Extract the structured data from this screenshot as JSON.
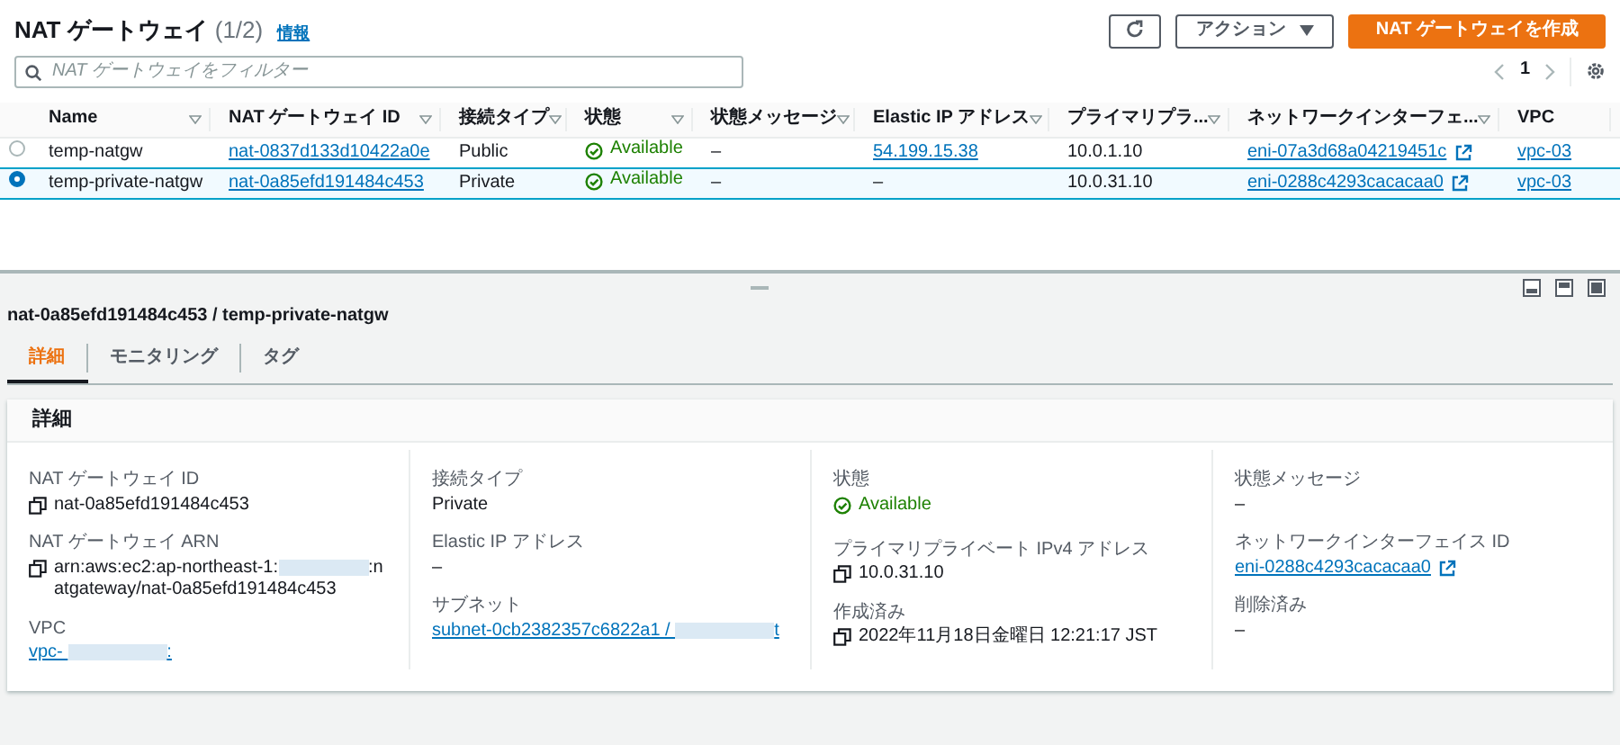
{
  "header": {
    "title": "NAT ゲートウェイ",
    "count": "(1/2)",
    "info_link": "情報"
  },
  "toolbar": {
    "actions_button": "アクション",
    "create_button": "NAT ゲートウェイを作成"
  },
  "search": {
    "placeholder": "NAT ゲートウェイをフィルター"
  },
  "pagination": {
    "page": "1"
  },
  "table": {
    "columns": [
      "Name",
      "NAT ゲートウェイ ID",
      "接続タイプ",
      "状態",
      "状態メッセージ",
      "Elastic IP アドレス",
      "プライマリプラ...",
      "ネットワークインターフェ...",
      "VPC"
    ],
    "rows": [
      {
        "selected": false,
        "cells": [
          {
            "kind": "text",
            "text": "temp-natgw"
          },
          {
            "kind": "link",
            "text": "nat-0837d133d10422a0e"
          },
          {
            "kind": "text",
            "text": "Public"
          },
          {
            "kind": "status",
            "text": "Available"
          },
          {
            "kind": "text",
            "text": "–"
          },
          {
            "kind": "link",
            "text": "54.199.15.38"
          },
          {
            "kind": "text",
            "text": "10.0.1.10"
          },
          {
            "kind": "external_link",
            "text": "eni-07a3d68a04219451c"
          },
          {
            "kind": "link",
            "text": "vpc-03"
          }
        ]
      },
      {
        "selected": true,
        "cells": [
          {
            "kind": "text",
            "text": "temp-private-natgw"
          },
          {
            "kind": "link",
            "text": "nat-0a85efd191484c453"
          },
          {
            "kind": "text",
            "text": "Private"
          },
          {
            "kind": "status",
            "text": "Available"
          },
          {
            "kind": "text",
            "text": "–"
          },
          {
            "kind": "text",
            "text": "–"
          },
          {
            "kind": "text",
            "text": "10.0.31.10"
          },
          {
            "kind": "external_link",
            "text": "eni-0288c4293cacacaa0"
          },
          {
            "kind": "link",
            "text": "vpc-03"
          }
        ]
      }
    ]
  },
  "detail": {
    "title": "nat-0a85efd191484c453 / temp-private-natgw",
    "tabs": [
      {
        "label": "詳細",
        "selected": true
      },
      {
        "label": "モニタリング",
        "selected": false
      },
      {
        "label": "タグ",
        "selected": false
      }
    ],
    "section_title": "詳細",
    "columns": [
      [
        {
          "label": "NAT ゲートウェイ ID",
          "kind": "copy",
          "value": "nat-0a85efd191484c453"
        },
        {
          "label": "NAT ゲートウェイ ARN",
          "kind": "copy_redacted",
          "parts": [
            "arn:aws:ec2:ap-northeast-1:",
            ":natgateway/nat-0a85efd191484c453"
          ]
        },
        {
          "label": "VPC",
          "kind": "link_redacted",
          "parts": [
            "vpc-",
            ":"
          ]
        }
      ],
      [
        {
          "label": "接続タイプ",
          "kind": "text",
          "value": "Private"
        },
        {
          "label": "Elastic IP アドレス",
          "kind": "text",
          "value": "–"
        },
        {
          "label": "サブネット",
          "kind": "link_redacted",
          "parts": [
            "subnet-0cb2382357c6822a1 /",
            "t"
          ]
        }
      ],
      [
        {
          "label": "状態",
          "kind": "status",
          "value": "Available"
        },
        {
          "label": "プライマリプライベート IPv4 アドレス",
          "kind": "copy",
          "value": "10.0.31.10"
        },
        {
          "label": "作成済み",
          "kind": "copy",
          "value": "2022年11月18日金曜日 12:21:17 JST"
        }
      ],
      [
        {
          "label": "状態メッセージ",
          "kind": "text",
          "value": "–"
        },
        {
          "label": "ネットワークインターフェイス ID",
          "kind": "external_link",
          "value": "eni-0288c4293cacacaa0"
        },
        {
          "label": "削除済み",
          "kind": "text",
          "value": "–"
        }
      ]
    ]
  }
}
